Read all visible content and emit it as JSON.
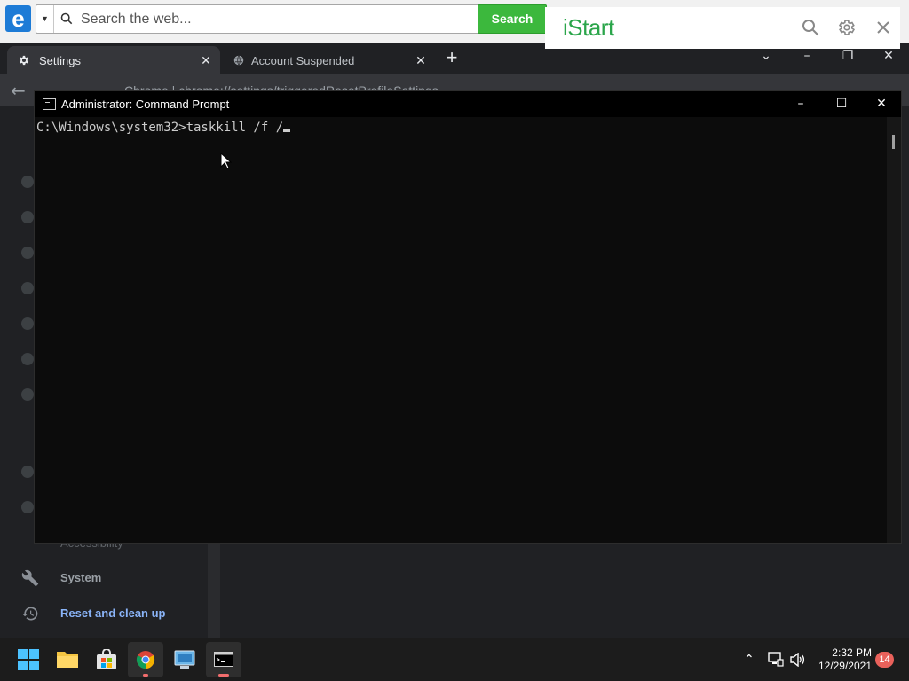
{
  "istart": {
    "search_placeholder": "Search the web...",
    "search_button": "Search",
    "brand": "iStart"
  },
  "browser": {
    "tabs": [
      {
        "label": "Settings",
        "active": true
      },
      {
        "label": "Account Suspended",
        "active": false
      }
    ],
    "omnibox_text": "Chrome  |  chrome://settings/triggeredResetProfileSettings",
    "sidebar_items": [
      {
        "label": "System"
      },
      {
        "label": "Reset and clean up"
      }
    ],
    "sidebar_faded": "Accessibility"
  },
  "cmd": {
    "title": "Administrator: Command Prompt",
    "prompt": "C:\\Windows\\system32>",
    "command": "taskkill /f /"
  },
  "taskbar": {
    "time": "2:32 PM",
    "date": "12/29/2021",
    "notification_count": "14"
  },
  "colors": {
    "istart_green": "#3cb83d",
    "cmd_bg": "#0c0c0c",
    "chrome_bg": "#202124",
    "badge": "#e9615b"
  }
}
